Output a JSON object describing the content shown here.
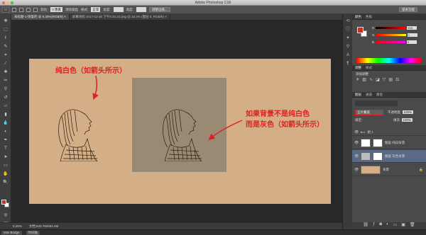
{
  "app": {
    "title": "Adobe Photoshop CS6"
  },
  "options_bar": {
    "feather_label": "羽化:",
    "feather_value": "0 像素",
    "antialias_label": "消除锯齿",
    "style_label": "样式:",
    "style_value": "正常",
    "width_label": "宽度:",
    "height_label": "高度:",
    "refine_edge_button": "调整边缘...",
    "workspace_button": "基本功能"
  },
  "tabs": [
    {
      "label": "未标题-1-恢复的 @ 6.25%(RGB/8) ×"
    },
    {
      "label": "屏幕快照 2017-12-30 下午9.33.24.png @ 33.3% (图层 0, RGB/8) ×"
    }
  ],
  "annotations": {
    "top_left": "纯白色（如箭头所示）",
    "right_line1": "如果背景不是纯白色",
    "right_line2": "而是灰色（如箭头所示）"
  },
  "status_bar": {
    "zoom": "6.25%",
    "doc": "文档:533.7M/593.4M"
  },
  "bottom_tabs": [
    "Mini Bridge",
    "时间轴"
  ],
  "color_panel": {
    "tabs": [
      "颜色",
      "色板"
    ],
    "r": "255",
    "g": "0",
    "b": "0",
    "fg_color": "#d22b1f"
  },
  "adjust_panel": {
    "tabs": [
      "调整",
      "样式"
    ],
    "label": "添加调整"
  },
  "layers_panel": {
    "tabs": [
      "图层",
      "通道",
      "路径"
    ],
    "blend_mode": "正片叠底",
    "opacity_label": "不透明度:",
    "opacity_value": "100%",
    "lock_label": "锁定:",
    "fill_label": "填充:",
    "fill_value": "100%",
    "layers": [
      {
        "name": "组 1",
        "type": "group"
      },
      {
        "name": "图层 纯白背景",
        "type": "layer"
      },
      {
        "name": "图层 灰色背景",
        "type": "layer"
      },
      {
        "name": "背景",
        "type": "background"
      }
    ]
  }
}
